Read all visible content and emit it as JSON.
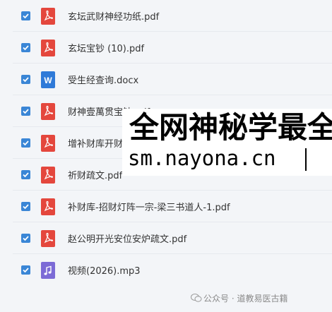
{
  "files": [
    {
      "name": "玄坛武财神经功纸.pdf",
      "type": "pdf",
      "icon": "pdf-icon"
    },
    {
      "name": "玄坛宝钞 (10).pdf",
      "type": "pdf",
      "icon": "pdf-icon"
    },
    {
      "name": "受生经查询.docx",
      "type": "doc",
      "icon": "word-icon"
    },
    {
      "name": "财神壹萬贯宝钞.pdf",
      "type": "pdf",
      "icon": "pdf-icon"
    },
    {
      "name": "增补财库开财门.pdf",
      "type": "pdf",
      "icon": "pdf-icon"
    },
    {
      "name": "祈财疏文.pdf",
      "type": "pdf",
      "icon": "pdf-icon"
    },
    {
      "name": "补财库-招财灯阵一宗-梁三书道人-1.pdf",
      "type": "pdf",
      "icon": "pdf-icon"
    },
    {
      "name": "赵公明开光安位安炉疏文.pdf",
      "type": "pdf",
      "icon": "pdf-icon"
    },
    {
      "name": "视频(2026).mp3",
      "type": "mp3",
      "icon": "audio-icon"
    }
  ],
  "overlay": {
    "line1": "全网神秘学最全",
    "line2": "sm.nayona.cn"
  },
  "watermark": "公众号 · 道教易医古籍",
  "colors": {
    "checkbox": "#3a86d6",
    "pdf": "#e4473d",
    "doc": "#2f7ad8",
    "mp3": "#7c6bd6"
  }
}
